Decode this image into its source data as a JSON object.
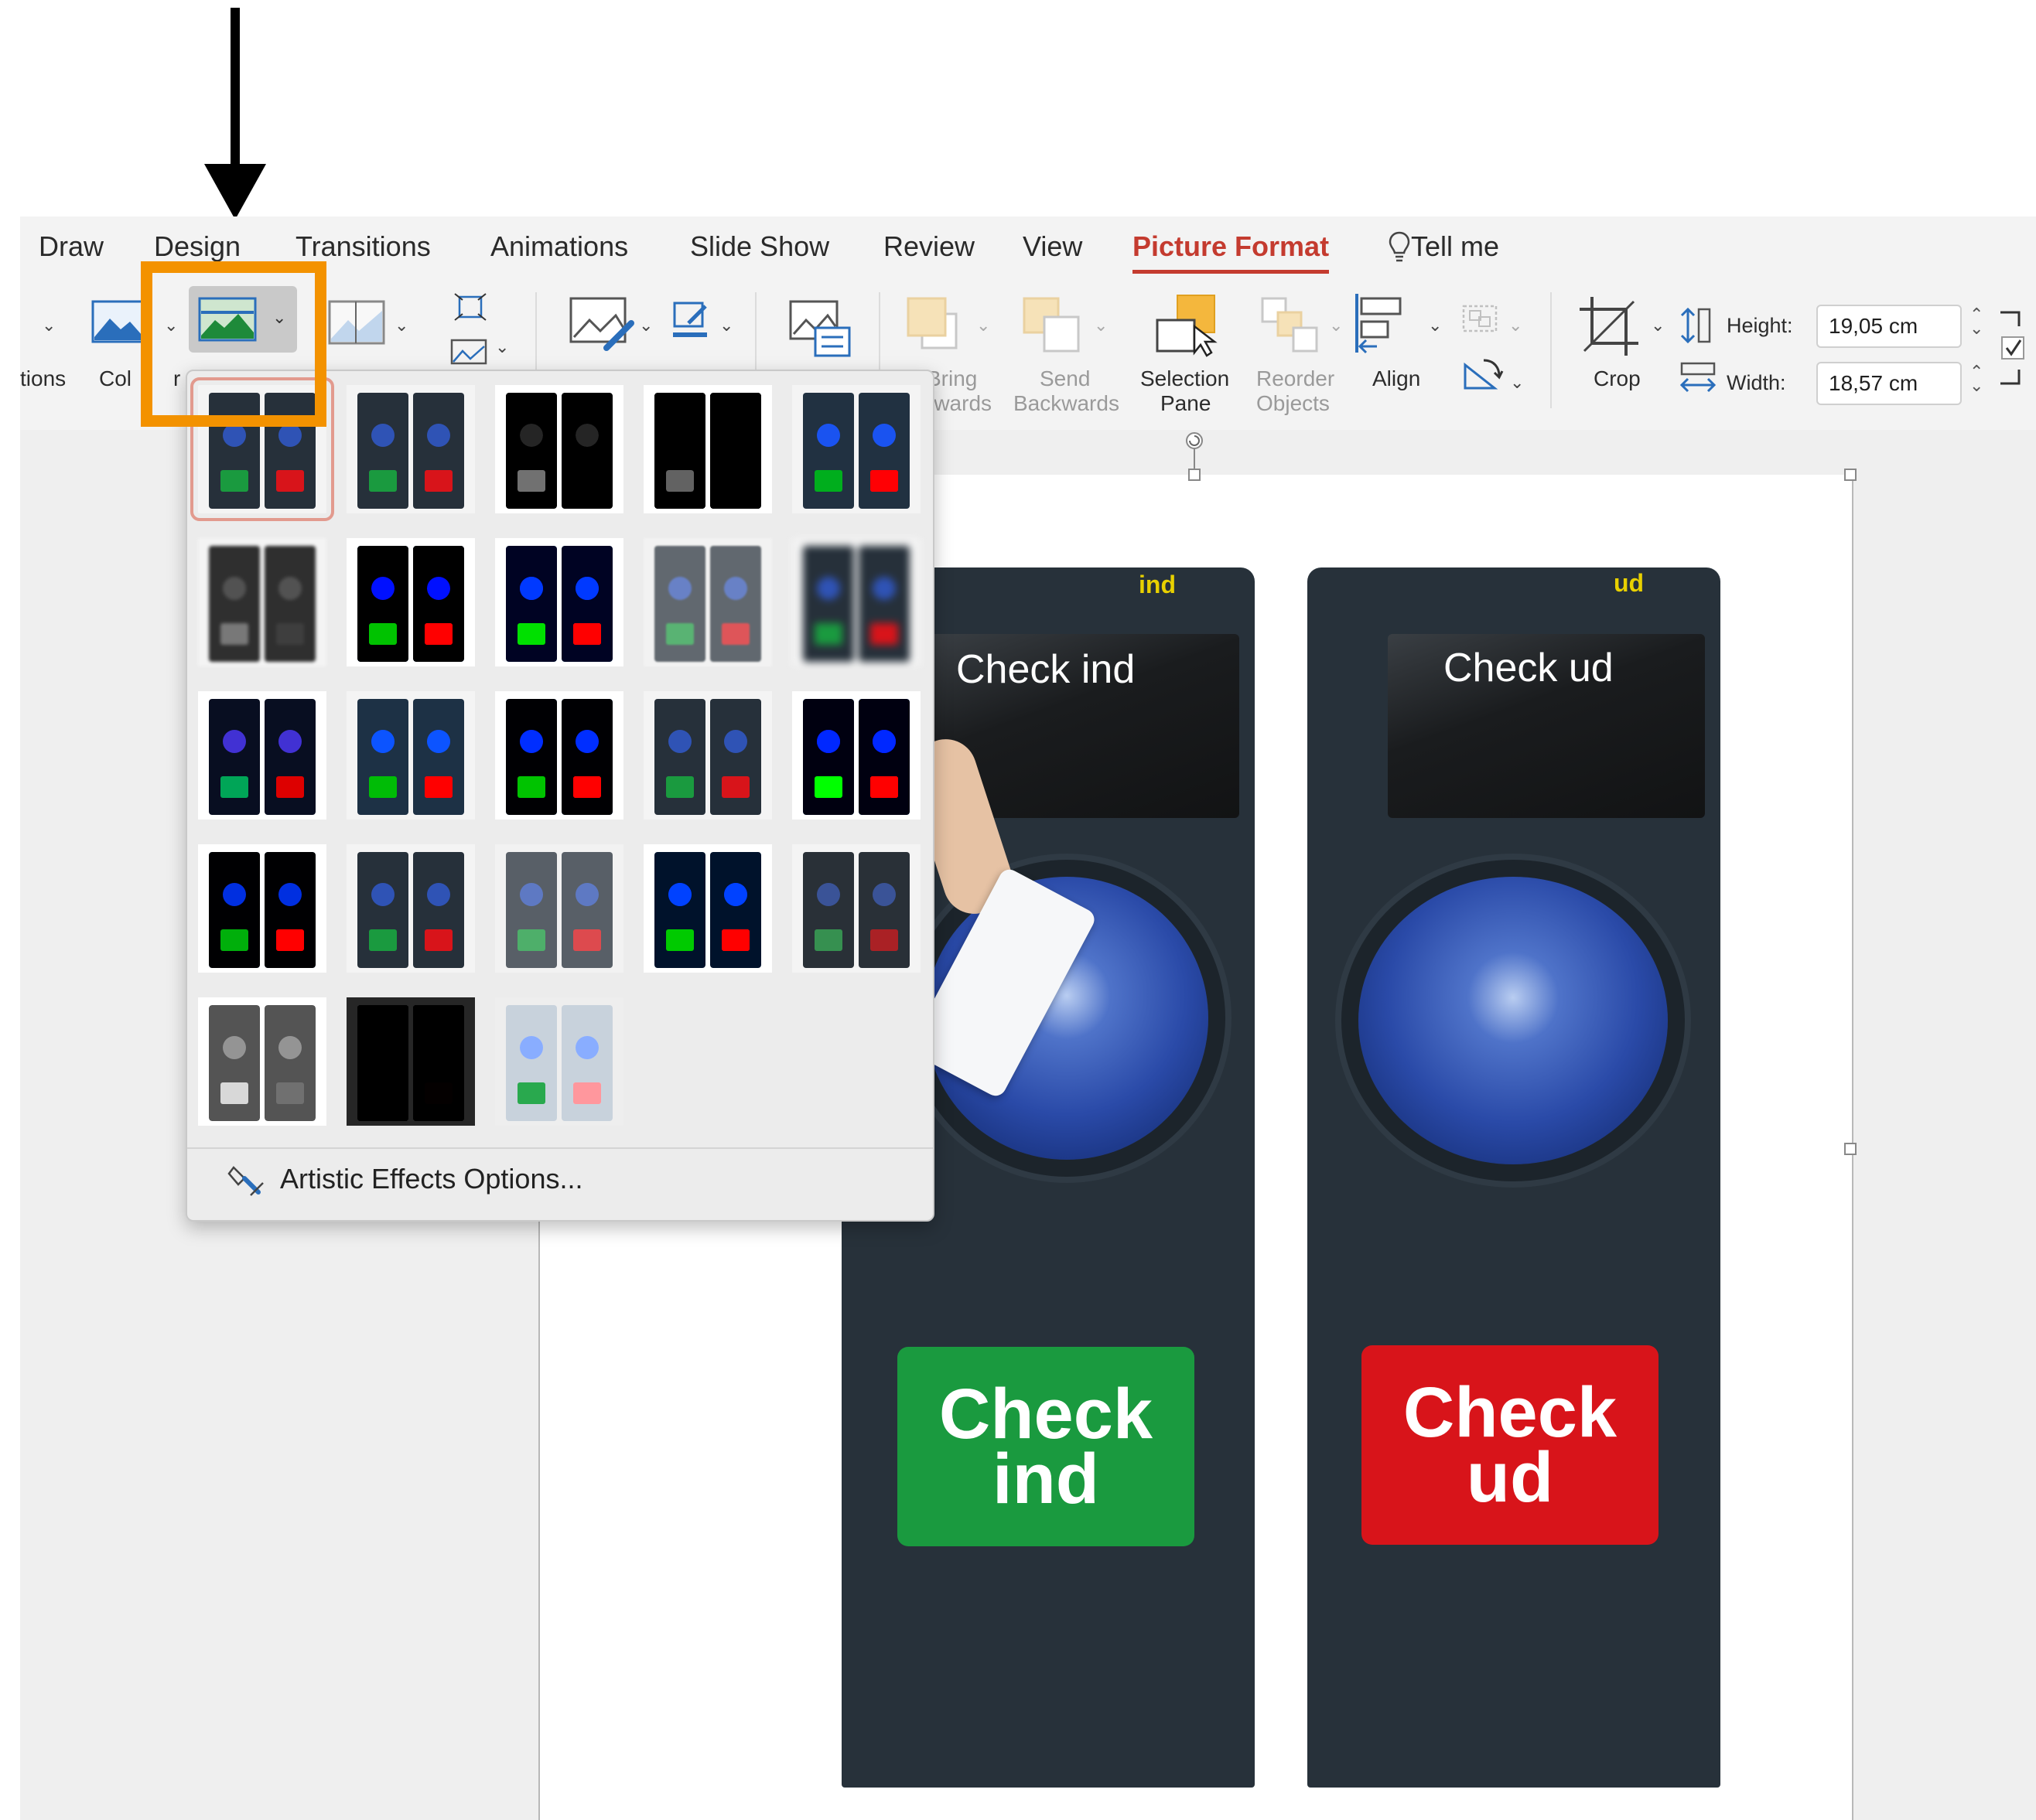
{
  "ribbon_tabs": {
    "draw": "Draw",
    "design": "Design",
    "transitions": "Transitions",
    "animations": "Animations",
    "slide_show": "Slide Show",
    "review": "Review",
    "view": "View",
    "picture_format": "Picture Format",
    "tell_me": "Tell me"
  },
  "ribbon": {
    "corrections_label": "tions",
    "color_label": "Col",
    "color_label_tail": "r",
    "bring_forward_label_1": "Bring",
    "bring_forward_label_2": "rwards",
    "send_backwards_label_1": "Send",
    "send_backwards_label_2": "Backwards",
    "selection_pane_label_1": "Selection",
    "selection_pane_label_2": "Pane",
    "reorder_label_1": "Reorder",
    "reorder_label_2": "Objects",
    "align_label": "Align",
    "crop_label": "Crop",
    "height_label": "Height:",
    "height_value": "19,05 cm",
    "width_label": "Width:",
    "width_value": "18,57 cm"
  },
  "artistic_effects": {
    "options_label": "Artistic Effects Options...",
    "selected_index": 0,
    "count": 23
  },
  "slide": {
    "left_device_tag": "ind",
    "right_device_tag": "ud",
    "left_screen_text": "Check ind",
    "right_screen_text": "Check ud",
    "left_button_line1": "Check",
    "left_button_line2": "ind",
    "right_button_line1": "Check",
    "right_button_line2": "ud"
  },
  "colors": {
    "accent": "#c43b2f",
    "highlight": "#f39200",
    "device": "#27313a",
    "green_button": "#1a9a3f",
    "red_button": "#d8141a",
    "tag_yellow": "#e8d000"
  }
}
